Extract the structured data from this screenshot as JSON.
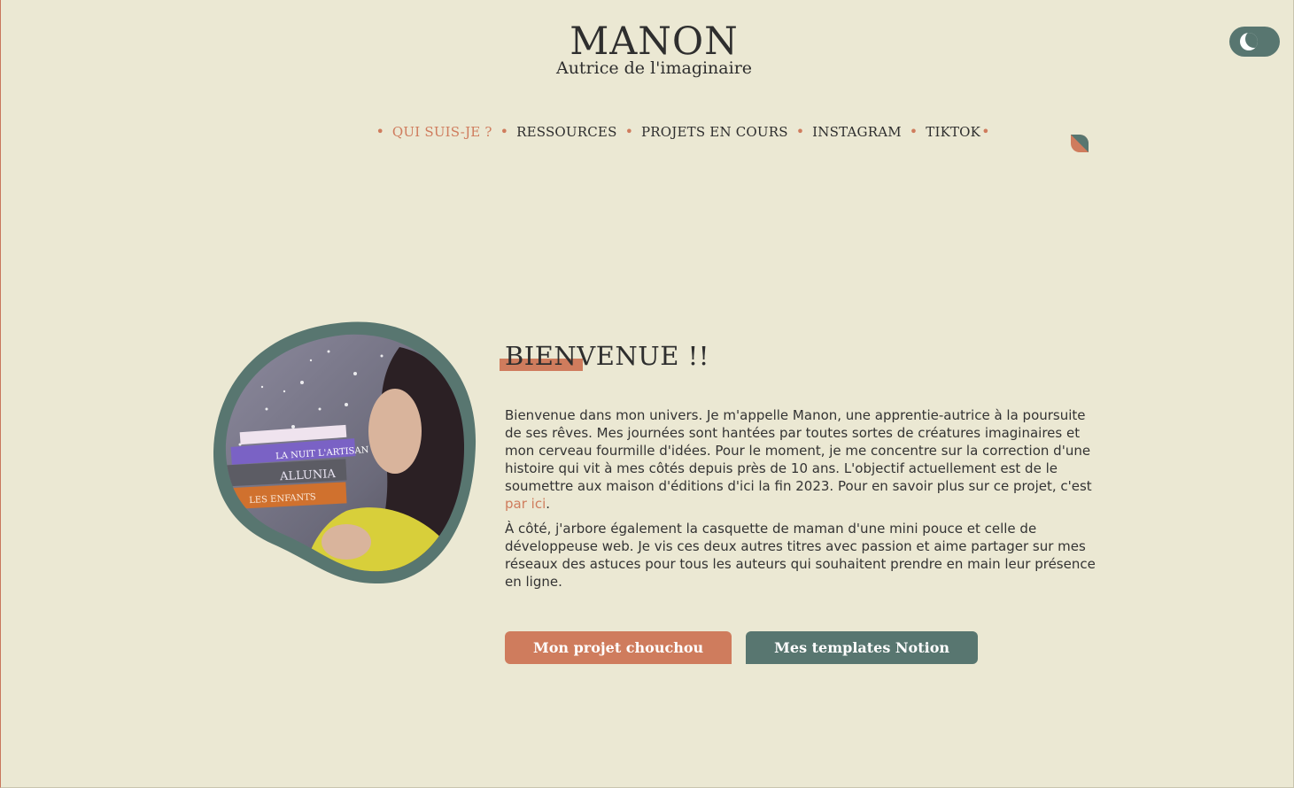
{
  "brand": {
    "title": "MANON",
    "subtitle": "Autrice de l'imaginaire"
  },
  "nav": {
    "items": [
      {
        "label": "QUI SUIS-JE ?",
        "active": true
      },
      {
        "label": "RESSOURCES"
      },
      {
        "label": "PROJETS EN COURS"
      },
      {
        "label": "INSTAGRAM"
      },
      {
        "label": "TIKTOK"
      }
    ]
  },
  "hero": {
    "title": "BIENVENUE !!",
    "paragraph1": "Bienvenue dans mon univers. Je m'appelle Manon, une apprentie-autrice à la poursuite de ses rêves. Mes journées sont hantées par toutes sortes de créatures imaginaires et mon cerveau fourmille d'idées. Pour le moment, je me concentre sur la correction d'une histoire qui vit à mes côtés depuis près de 10 ans. L'objectif actuellement est de le soumettre aux maison d'éditions d'ici la fin 2023. Pour en savoir plus sur ce projet, c'est ",
    "paragraph1_link": "par ici",
    "paragraph1_end": ".",
    "paragraph2": "À côté, j'arbore également la casquette de maman d'une mini pouce et celle de développeuse web. Je vis ces deux autres titres avec passion et aime partager sur mes réseaux des astuces pour tous les auteurs qui souhaitent prendre en main leur présence en ligne.",
    "button_primary": "Mon projet chouchou",
    "button_secondary": "Mes templates Notion"
  },
  "photo": {
    "book_titles": [
      "ALLUNIA",
      "LES ENFANTS",
      "LA NUIT L'ARTISAN"
    ]
  },
  "colors": {
    "background": "#ebe8d3",
    "accent": "#cf7c5d",
    "teal": "#587670",
    "text": "#2e2e2e"
  },
  "icons": {
    "theme_toggle": "moon-icon",
    "decor": "leaf-icon"
  }
}
